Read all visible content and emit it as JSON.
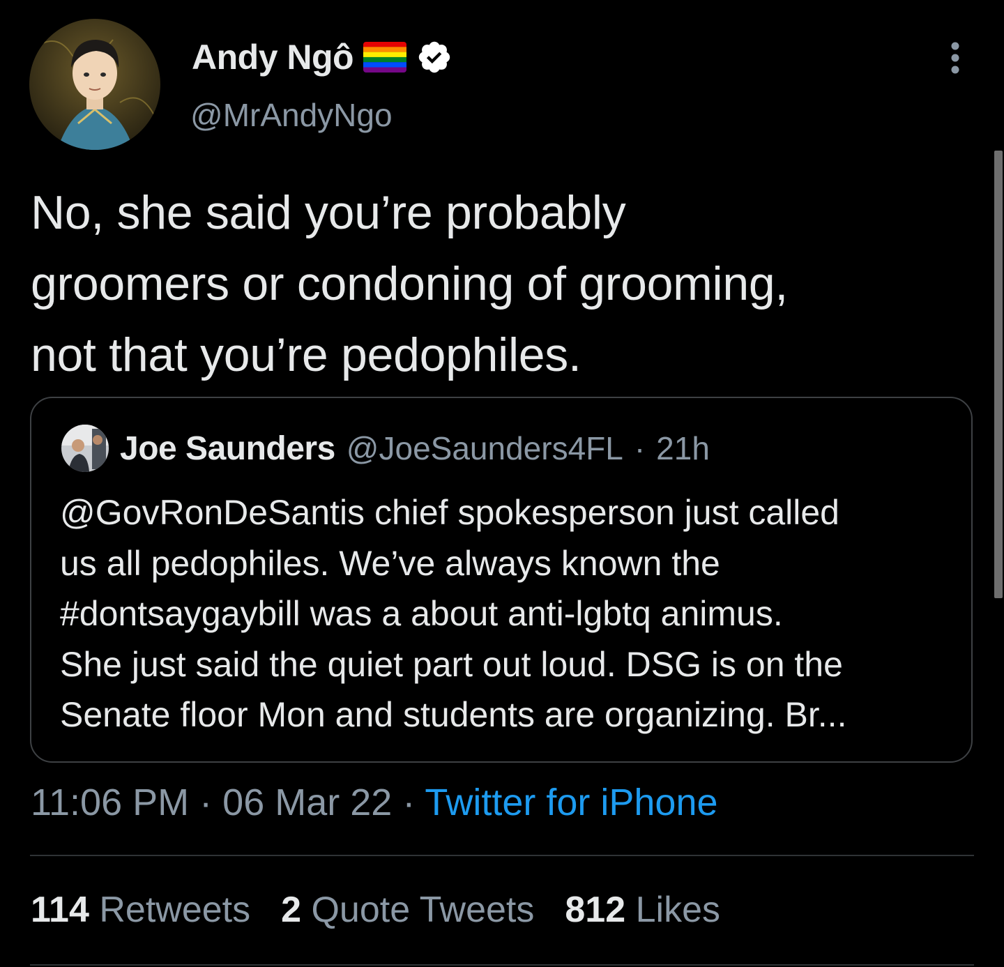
{
  "author": {
    "name": "Andy Ngô",
    "handle": "@MrAndyNgo",
    "flag_icon": "rainbow-flag-icon",
    "verified_icon": "verified-badge-icon"
  },
  "tweet": {
    "text": "No, she said you’re probably\ngroomers or condoning of grooming,\nnot that you’re pedophiles."
  },
  "quoted_tweet": {
    "name": "Joe Saunders",
    "handle": "@JoeSaunders4FL",
    "separator": "·",
    "time": "21h",
    "text": "@GovRonDeSantis chief spokesperson just called\nus all pedophiles. We’ve always known the\n#dontsaygaybill was a about anti-lgbtq animus.\nShe just said the quiet part out loud. DSG is on the\nSenate floor Mon and students are organizing. Br..."
  },
  "meta": {
    "time": "11:06 PM",
    "separator": "·",
    "date": "06 Mar 22",
    "source": "Twitter for iPhone"
  },
  "stats": {
    "retweets_count": "114",
    "retweets_label": "Retweets",
    "quotes_count": "2",
    "quotes_label": "Quote Tweets",
    "likes_count": "812",
    "likes_label": "Likes"
  },
  "colors": {
    "background": "#000000",
    "text": "#e7e9ea",
    "secondary": "#8b98a5",
    "link": "#1d9bf0",
    "border": "#3e4144"
  }
}
